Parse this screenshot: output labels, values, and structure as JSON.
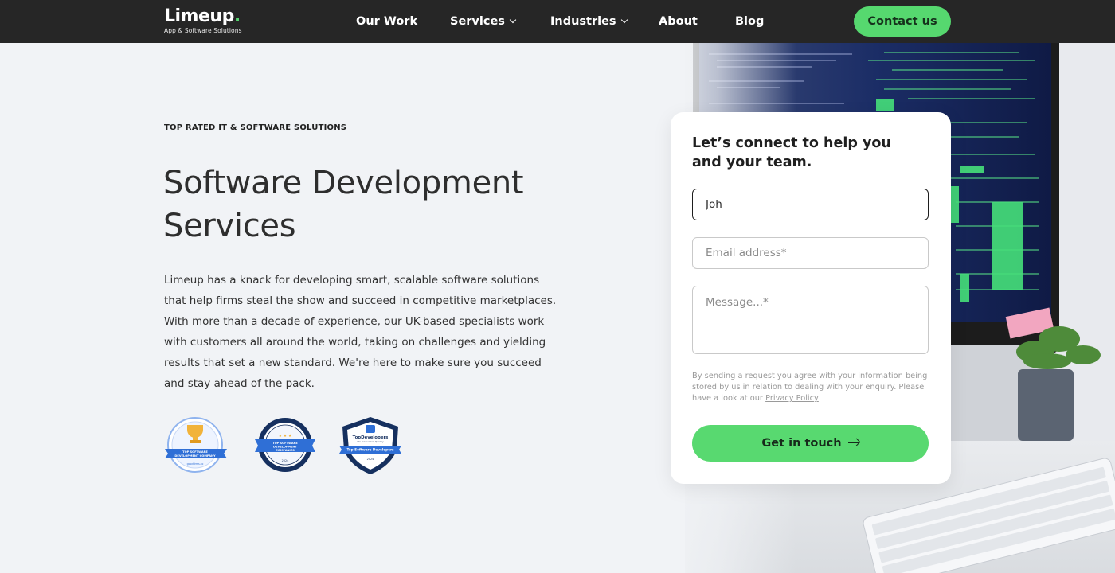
{
  "nav": {
    "logo_word": "Limeup",
    "logo_dot": ".",
    "logo_tagline": "App & Software Solutions",
    "items": [
      {
        "label": "Our Work",
        "has_dropdown": false
      },
      {
        "label": "Services",
        "has_dropdown": true
      },
      {
        "label": "Industries",
        "has_dropdown": true
      },
      {
        "label": "About",
        "has_dropdown": false
      },
      {
        "label": "Blog",
        "has_dropdown": false
      }
    ],
    "cta_label": "Contact us"
  },
  "hero": {
    "eyebrow": "TOP RATED IT & SOFTWARE SOLUTIONS",
    "title_line1": "Software Development",
    "title_line2": "Services",
    "body": "Limeup has a knack for developing smart, scalable software solutions that help firms steal the show and succeed in competitive marketplaces. With more than a decade of experience, our UK-based specialists work with customers all around the world, taking on challenges and yielding results that set a new standard. We're here to make sure you succeed and stay ahead of the pack."
  },
  "badges": [
    {
      "lines": [
        "TOP SOFTWARE",
        "DEVELOPMENT COMPANY"
      ],
      "footer": "goodfirms.co"
    },
    {
      "lines": [
        "TOP SOFTWARE",
        "DEVELOPMENT",
        "COMPANIES"
      ],
      "footer": "2024"
    },
    {
      "brand": "TopDevelopers",
      "subbrand": "Pin Innovation Quality",
      "ribbon": "Top Software Developers",
      "footer": "2024"
    }
  ],
  "form": {
    "title": "Let’s connect to help you and your team.",
    "name_value": "Joh",
    "email_placeholder": "Email address*",
    "message_placeholder": "Message...*",
    "consent_text": "By sending a request you agree with your information being stored by us in relation to dealing with your enquiry. Please have a look at our ",
    "privacy_link": "Privacy Policy",
    "submit_label": "Get in touch"
  },
  "colors": {
    "accent_green": "#56d86f",
    "nav_bg": "#262626",
    "page_bg": "#f1f3f6",
    "badge_blue": "#2f6fd6",
    "badge_navy": "#16305f"
  }
}
